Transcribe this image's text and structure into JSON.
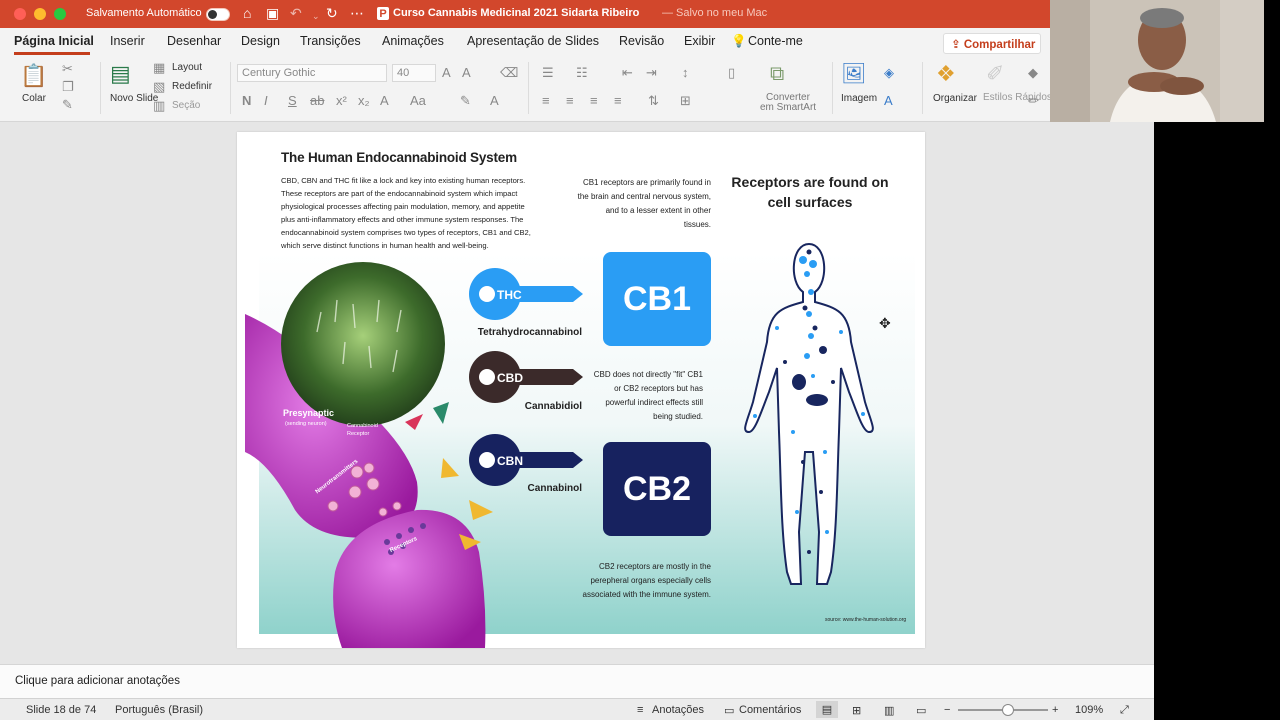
{
  "window": {
    "autosave_label": "Salvamento Automático",
    "autosave_state": "off",
    "doc_title": "Curso Cannabis Medicinal 2021 Sidarta Ribeiro",
    "save_status": "— Salvo no meu Mac",
    "accent": "#d2472c"
  },
  "tabs": [
    {
      "label": "Página Inicial",
      "active": true
    },
    {
      "label": "Inserir"
    },
    {
      "label": "Desenhar"
    },
    {
      "label": "Design"
    },
    {
      "label": "Transições"
    },
    {
      "label": "Animações"
    },
    {
      "label": "Apresentação de Slides"
    },
    {
      "label": "Revisão"
    },
    {
      "label": "Exibir"
    }
  ],
  "tell_me": "Conte-me",
  "share_label": "Compartilhar",
  "ribbon": {
    "paste": "Colar",
    "new_slide": "Novo Slide",
    "layout": "Layout",
    "reset": "Redefinir",
    "section": "Seção",
    "font_name": "Century Gothic",
    "font_size": "40",
    "convert_smartart": "Converter em SmartArt",
    "image": "Imagem",
    "arrange": "Organizar",
    "quick_styles": "Estilos Rápidos"
  },
  "slide": {
    "title": "The Human Endocannabinoid System",
    "intro": "CBD, CBN and THC fit like a lock and key into existing human receptors. These receptors are part of the endocannabinoid system which impact physiological processes affecting pain modulation, memory, and appetite plus anti-inflammatory effects and other immune system responses. The endocannabinoid system comprises two types of receptors, CB1 and CB2, which serve distinct functions in human health and well-being.",
    "cb1_text": "CB1 receptors are primarily found in the brain and central nervous system, and to a lesser extent in other tissues.",
    "receptors_title": "Receptors are found on cell surfaces",
    "cb1_label": "CB1",
    "cb2_label": "CB2",
    "cbd_text": "CBD does not directly \"fit\" CB1 or CB2 receptors but has powerful indirect effects still being studied.",
    "cb2_text": "CB2 receptors are mostly in the perepheral organs especially cells associated with the immune system.",
    "source": "source: www.the-human-solution.org",
    "keys": [
      {
        "tag": "THC",
        "name": "Tetrahydrocannabinol",
        "color": "#2a9df4"
      },
      {
        "tag": "CBD",
        "name": "Cannabidiol",
        "color": "#3b2a2a"
      },
      {
        "tag": "CBN",
        "name": "Cannabinol",
        "color": "#17225f"
      }
    ],
    "synapse": {
      "presynaptic": "Presynaptic",
      "sending": "(sending neuron)",
      "cannabinoid_receptor": "Cannabinoid Receptor",
      "neurotransmitters": "Neurotransmitters",
      "receptors": "Receptors"
    }
  },
  "notes_placeholder": "Clique para adicionar anotações",
  "status": {
    "slide_info": "Slide 18 de 74",
    "language": "Português (Brasil)",
    "notes_btn": "Anotações",
    "comments_btn": "Comentários",
    "zoom": "109%",
    "zoom_fraction": 0.55
  }
}
